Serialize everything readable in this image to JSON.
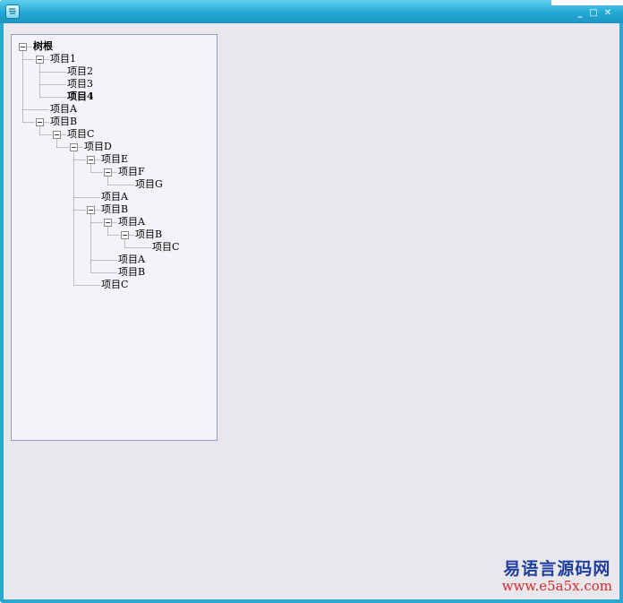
{
  "window": {
    "minimize_glyph": "_",
    "maximize_glyph": "□",
    "close_glyph": "✕"
  },
  "tree": {
    "root": {
      "label": "树根",
      "bold": true,
      "expanded": true
    },
    "items": [
      {
        "id": "n1",
        "label": "项目1",
        "depth": 1,
        "expanded": true
      },
      {
        "id": "n2",
        "label": "项目2",
        "depth": 2
      },
      {
        "id": "n3",
        "label": "项目3",
        "depth": 2
      },
      {
        "id": "n4",
        "label": "项目4",
        "depth": 2,
        "bold": true
      },
      {
        "id": "nA1",
        "label": "项目A",
        "depth": 1
      },
      {
        "id": "nB1",
        "label": "项目B",
        "depth": 1,
        "expanded": true
      },
      {
        "id": "nC1",
        "label": "项目C",
        "depth": 2,
        "expanded": true
      },
      {
        "id": "nD",
        "label": "项目D",
        "depth": 3,
        "expanded": true
      },
      {
        "id": "nE",
        "label": "项目E",
        "depth": 4,
        "expanded": true
      },
      {
        "id": "nF",
        "label": "项目F",
        "depth": 5,
        "expanded": true
      },
      {
        "id": "nG",
        "label": "项目G",
        "depth": 6
      },
      {
        "id": "nA2",
        "label": "项目A",
        "depth": 4
      },
      {
        "id": "nB2",
        "label": "项目B",
        "depth": 4,
        "expanded": true
      },
      {
        "id": "nA3",
        "label": "项目A",
        "depth": 5,
        "expanded": true
      },
      {
        "id": "nB3",
        "label": "项目B",
        "depth": 6,
        "expanded": true
      },
      {
        "id": "nC2",
        "label": "项目C",
        "depth": 7
      },
      {
        "id": "nA4",
        "label": "项目A",
        "depth": 5
      },
      {
        "id": "nB4",
        "label": "项目B",
        "depth": 5
      },
      {
        "id": "nC3",
        "label": "项目C",
        "depth": 4
      }
    ]
  },
  "watermark": {
    "title": "易语言源码网",
    "url": "www.e5a5x.com",
    "title_color": "#1e3f9e",
    "url_color": "#d42a2a"
  },
  "colors": {
    "title_bar": "#22a8d4",
    "client_bg": "#e9e7ec",
    "tree_border": "#8ea1c4"
  }
}
